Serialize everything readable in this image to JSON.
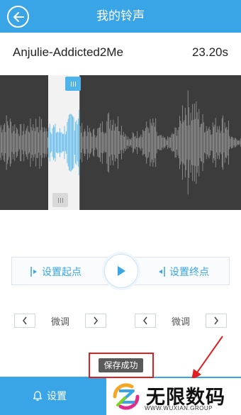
{
  "header": {
    "title": "我的铃声",
    "back_icon": "back-arrow-icon"
  },
  "song": {
    "name": "Anjulie-Addicted2Me",
    "duration": "23.20s"
  },
  "waveform": {
    "selection_start": 0.2,
    "selection_end": 0.33
  },
  "controls": {
    "set_start_label": "设置起点",
    "set_end_label": "设置终点",
    "play_icon": "play-icon"
  },
  "fine_tune": {
    "left_label": "微调",
    "right_label": "微调"
  },
  "toast": {
    "text": "保存成功"
  },
  "bottom_bar": {
    "settings_label": "设置",
    "settings_icon": "bell-icon"
  },
  "watermark": {
    "title": "无限数码",
    "subtitle": "WWW.WUXIAN.GROUP"
  },
  "colors": {
    "primary": "#3aa5e6",
    "wave_background": "#3c3c3c",
    "wave_selected": "#4fb4ea",
    "annotation_red": "#e02020"
  }
}
